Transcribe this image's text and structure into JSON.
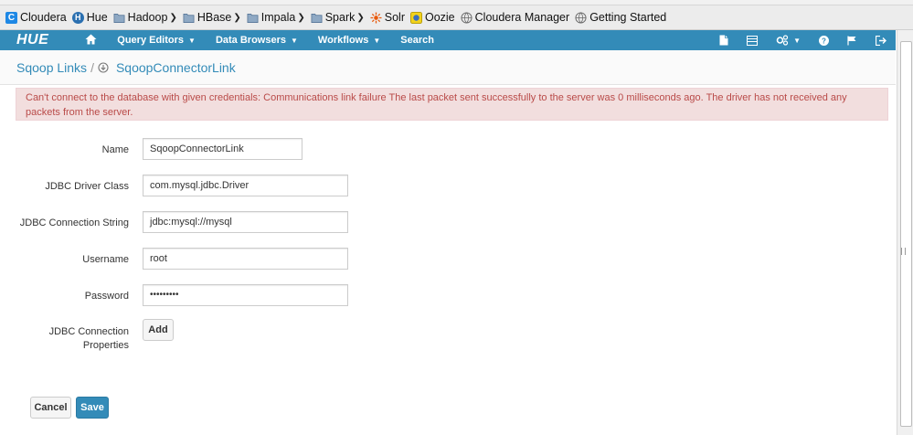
{
  "bookmarks": [
    {
      "label": "Cloudera",
      "icon": "cloudera-icon",
      "dropdown": false
    },
    {
      "label": "Hue",
      "icon": "hue-icon",
      "dropdown": false
    },
    {
      "label": "Hadoop",
      "icon": "folder-icon",
      "dropdown": true
    },
    {
      "label": "HBase",
      "icon": "folder-icon",
      "dropdown": true
    },
    {
      "label": "Impala",
      "icon": "folder-icon",
      "dropdown": true
    },
    {
      "label": "Spark",
      "icon": "folder-icon",
      "dropdown": true
    },
    {
      "label": "Solr",
      "icon": "solr-icon",
      "dropdown": false
    },
    {
      "label": "Oozie",
      "icon": "oozie-icon",
      "dropdown": false
    },
    {
      "label": "Cloudera Manager",
      "icon": "globe-icon",
      "dropdown": false
    },
    {
      "label": "Getting Started",
      "icon": "globe-icon",
      "dropdown": false
    }
  ],
  "navbar": {
    "logo": "HUE",
    "items": [
      "Query Editors",
      "Data Browsers",
      "Workflows",
      "Search"
    ],
    "right_icons": [
      "document-icon",
      "table-icon",
      "settings-icon",
      "help-icon",
      "flag-icon",
      "logout-icon"
    ]
  },
  "breadcrumb": {
    "parent": "Sqoop Links",
    "separator": "/",
    "current": "SqoopConnectorLink"
  },
  "alert": {
    "message": "Can't connect to the database with given credentials: Communications link failure The last packet sent successfully to the server was 0 milliseconds ago. The driver has not received any packets from the server."
  },
  "form": {
    "name_label": "Name",
    "name_value": "SqoopConnectorLink",
    "driver_label": "JDBC Driver Class",
    "driver_value": "com.mysql.jdbc.Driver",
    "conn_label": "JDBC Connection String",
    "conn_value": "jdbc:mysql://mysql",
    "user_label": "Username",
    "user_value": "root",
    "password_label": "Password",
    "password_value": "•••••••••",
    "props_label_1": "JDBC Connection",
    "props_label_2": "Properties",
    "add_label": "Add"
  },
  "actions": {
    "cancel_label": "Cancel",
    "save_label": "Save"
  },
  "colors": {
    "brand": "#338bb8",
    "alert_bg": "#f2dede",
    "alert_text": "#b94a48"
  }
}
